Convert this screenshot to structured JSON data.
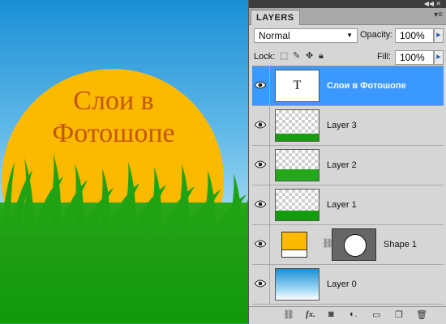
{
  "canvas": {
    "text_line1": "Слои в",
    "text_line2": "Фотошопе",
    "colors": {
      "sun": "#fbb900",
      "text": "#c4560a",
      "grass": "#1e9c12",
      "sky": "#1a8fd6"
    }
  },
  "panel": {
    "tab_label": "LAYERS",
    "blend_mode": "Normal",
    "opacity_label": "Opacity:",
    "opacity_value": "100%",
    "lock_label": "Lock:",
    "fill_label": "Fill:",
    "fill_value": "100%",
    "layers": [
      {
        "name": "Слои в Фотошопе",
        "type": "text",
        "thumb_glyph": "T",
        "selected": true
      },
      {
        "name": "Layer 3",
        "type": "grass"
      },
      {
        "name": "Layer 2",
        "type": "grass"
      },
      {
        "name": "Layer 1",
        "type": "grass"
      },
      {
        "name": "Shape 1",
        "type": "shape"
      },
      {
        "name": "Layer 0",
        "type": "gradient"
      }
    ],
    "bottom_icons": [
      "link-layers-icon",
      "fx-icon",
      "add-mask-icon",
      "adjustment-icon",
      "new-group-icon",
      "new-layer-icon",
      "trash-icon"
    ],
    "accent_color": "#3a98fe"
  }
}
